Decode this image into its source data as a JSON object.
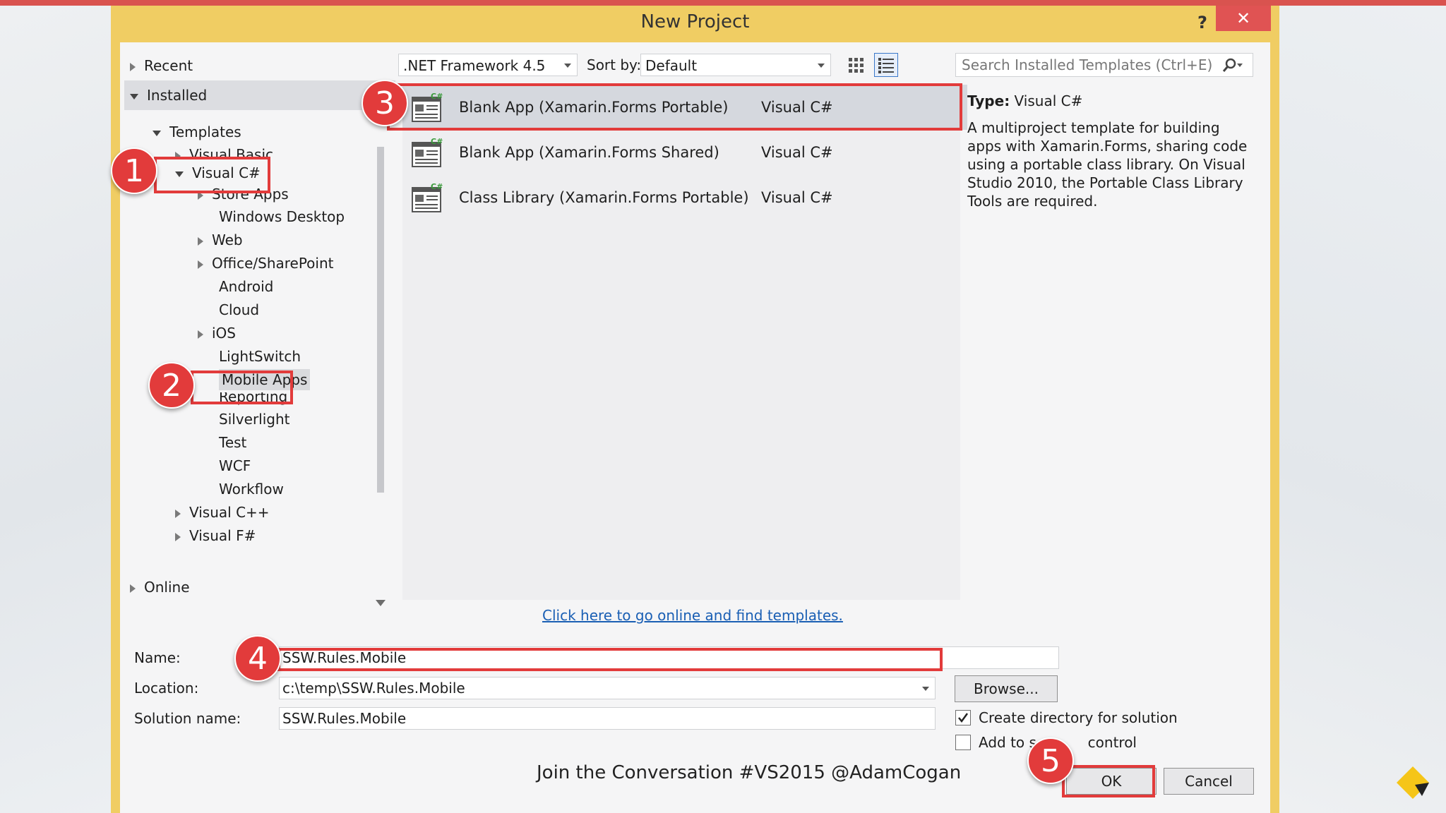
{
  "window": {
    "title": "New Project",
    "help_label": "?",
    "close_label": "✕"
  },
  "tree": {
    "recent": "Recent",
    "installed": "Installed",
    "templates": "Templates",
    "visual_basic": "Visual Basic",
    "visual_csharp": "Visual C#",
    "items": [
      "Store Apps",
      "Windows Desktop",
      "Web",
      "Office/SharePoint",
      "Android",
      "Cloud",
      "iOS",
      "LightSwitch",
      "Mobile Apps",
      "Reporting",
      "Silverlight",
      "Test",
      "WCF",
      "Workflow"
    ],
    "visual_cpp": "Visual C++",
    "visual_fsharp": "Visual F#",
    "online": "Online"
  },
  "toolbar": {
    "framework": ".NET Framework 4.5",
    "sort_label": "Sort by:",
    "sort_value": "Default",
    "search_placeholder": "Search Installed Templates (Ctrl+E)"
  },
  "templates": [
    {
      "name": "Blank App (Xamarin.Forms Portable)",
      "lang": "Visual C#",
      "selected": true
    },
    {
      "name": "Blank App (Xamarin.Forms Shared)",
      "lang": "Visual C#",
      "selected": false
    },
    {
      "name": "Class Library (Xamarin.Forms Portable)",
      "lang": "Visual C#",
      "selected": false
    }
  ],
  "description": {
    "type_key": "Type:",
    "type_value": "Visual C#",
    "text": "A multiproject template for building apps with Xamarin.Forms, sharing code using a portable class library. On Visual Studio 2010, the Portable Class Library Tools are required."
  },
  "online_link": "Click here to go online and find templates.",
  "form": {
    "name_label": "Name:",
    "name_value": "SSW.Rules.Mobile",
    "location_label": "Location:",
    "location_value": "c:\\temp\\SSW.Rules.Mobile",
    "solution_label": "Solution name:",
    "solution_value": "SSW.Rules.Mobile",
    "browse": "Browse...",
    "create_dir": "Create directory for solution",
    "create_dir_checked": true,
    "add_source_prefix": "Add to s",
    "add_source_suffix": "control",
    "add_source_checked": false,
    "ok": "OK",
    "cancel": "Cancel"
  },
  "annotations": [
    "1",
    "2",
    "3",
    "4",
    "5"
  ],
  "footer": "Join the Conversation #VS2015 @AdamCogan",
  "colors": {
    "dialog_frame": "#f0cd63",
    "highlight": "#e23b3b",
    "selected_row": "#d5d8de",
    "link": "#1a5fb4"
  }
}
